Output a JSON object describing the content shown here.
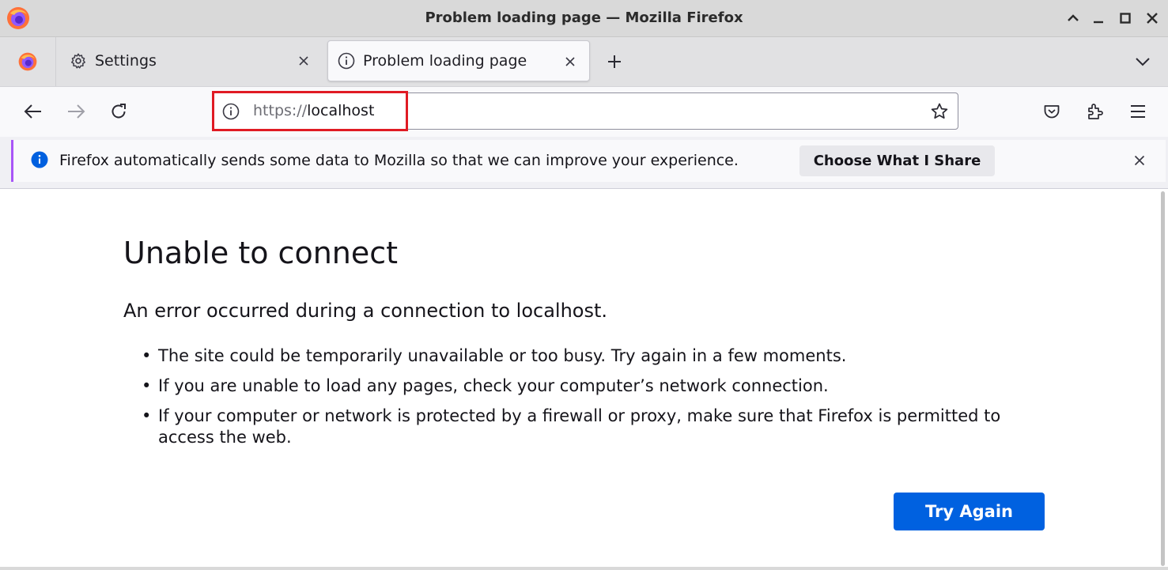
{
  "window": {
    "title": "Problem loading page — Mozilla Firefox"
  },
  "tabs": [
    {
      "label": "Settings",
      "icon": "gear-icon"
    },
    {
      "label": "Problem loading page",
      "icon": "info-icon",
      "active": true
    }
  ],
  "navbar": {
    "url_scheme": "https://",
    "url_host": "localhost"
  },
  "notification": {
    "text": "Firefox automatically sends some data to Mozilla so that we can improve your experience.",
    "button": "Choose What I Share"
  },
  "error_page": {
    "title": "Unable to connect",
    "description": "An error occurred during a connection to localhost.",
    "items": [
      "The site could be temporarily unavailable or too busy. Try again in a few moments.",
      "If you are unable to load any pages, check your computer’s network connection.",
      "If your computer or network is protected by a firewall or proxy, make sure that Firefox is permitted to access the web."
    ],
    "button": "Try Again"
  },
  "colors": {
    "primary_button": "#0061e0",
    "highlight_border": "#e01b24",
    "notification_accent": "#a855f7",
    "info_blue": "#0060df"
  }
}
